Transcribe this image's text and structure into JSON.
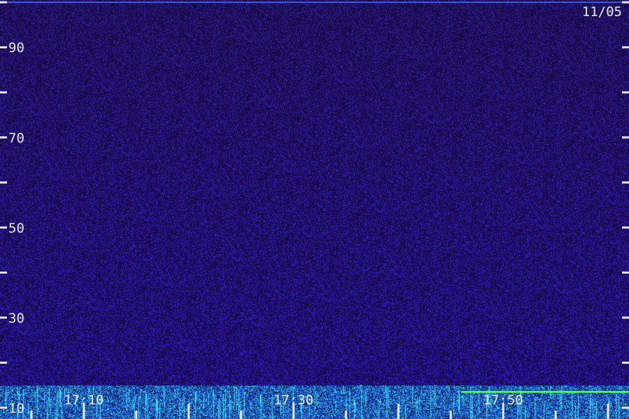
{
  "chart_data": {
    "type": "heatmap",
    "date_label": "11/05",
    "y_ticks": [
      10,
      20,
      30,
      40,
      50,
      60,
      70,
      80,
      90,
      100
    ],
    "y_tick_labels": [
      "10",
      "30",
      "50",
      "70",
      "90"
    ],
    "ylim": [
      7.5,
      100.5
    ],
    "x_tick_labels": [
      "17:10",
      "17:30",
      "17:50"
    ],
    "x_tick_values": [
      "17:10",
      "17:30",
      "17:50"
    ],
    "x_minor_step_min": 5,
    "xlim": [
      "17:02",
      "18:02"
    ],
    "signals": [
      {
        "freq": 100,
        "start": "17:02",
        "end": "18:02",
        "strength": "medium",
        "color": "#3a6cff"
      },
      {
        "freq": 13.5,
        "start": "17:46",
        "end": "18:02",
        "strength": "strong",
        "color": "#5cff5c"
      }
    ],
    "colors": {
      "background": "#22104f",
      "noise_low": "#150838",
      "noise_high": "#3a1aa0",
      "band_low": "#1a4fd8",
      "band_high": "#33d8ff",
      "band_peak": "#5cff5c",
      "text": "#e8e8e8"
    }
  }
}
